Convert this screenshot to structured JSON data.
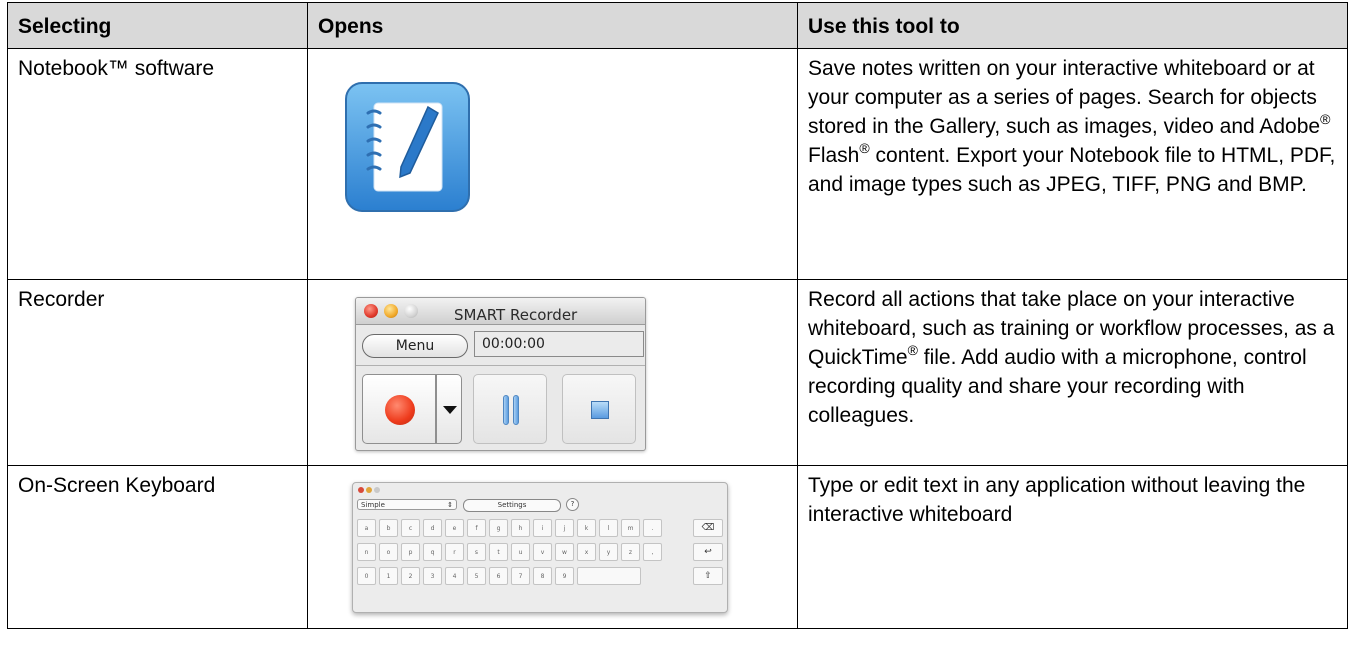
{
  "headers": [
    "Selecting",
    "Opens",
    "Use this tool to"
  ],
  "rows": [
    {
      "selecting": "Notebook™ software",
      "opens": "notebook-app-icon",
      "description_html": "Save notes written on your interactive whiteboard or at your computer as a series of pages. Search for objects stored in the Gallery, such as images, video and Adobe<sup>®</sup> Flash<sup>®</sup> content. Export your Notebook file to HTML, PDF, and image types such as JPEG, TIFF, PNG and BMP."
    },
    {
      "selecting": "Recorder",
      "opens": "smart-recorder-window",
      "description_html": "Record all actions that take place on your interactive whiteboard, such as training or workflow processes, as a QuickTime<sup>®</sup> file. Add audio with a microphone, control recording quality and share your recording with colleagues."
    },
    {
      "selecting": "On-Screen Keyboard",
      "opens": "on-screen-keyboard-window",
      "description_html": "Type or edit text in any application without leaving the interactive whiteboard"
    }
  ],
  "recorder": {
    "title": "SMART Recorder",
    "menu_label": "Menu",
    "time": "00:00:00"
  },
  "keyboard": {
    "layout_value": "Simple",
    "settings_label": "Settings",
    "help_label": "?",
    "key_rows": [
      [
        "a",
        "b",
        "c",
        "d",
        "e",
        "f",
        "g",
        "h",
        "i",
        "j",
        "k",
        "l",
        "m",
        ".",
        "⌫"
      ],
      [
        "n",
        "o",
        "p",
        "q",
        "r",
        "s",
        "t",
        "u",
        "v",
        "w",
        "x",
        "y",
        "z",
        ",",
        "↩"
      ],
      [
        "0",
        "1",
        "2",
        "3",
        "4",
        "5",
        "6",
        "7",
        "8",
        "9",
        "",
        "⇧"
      ]
    ]
  }
}
